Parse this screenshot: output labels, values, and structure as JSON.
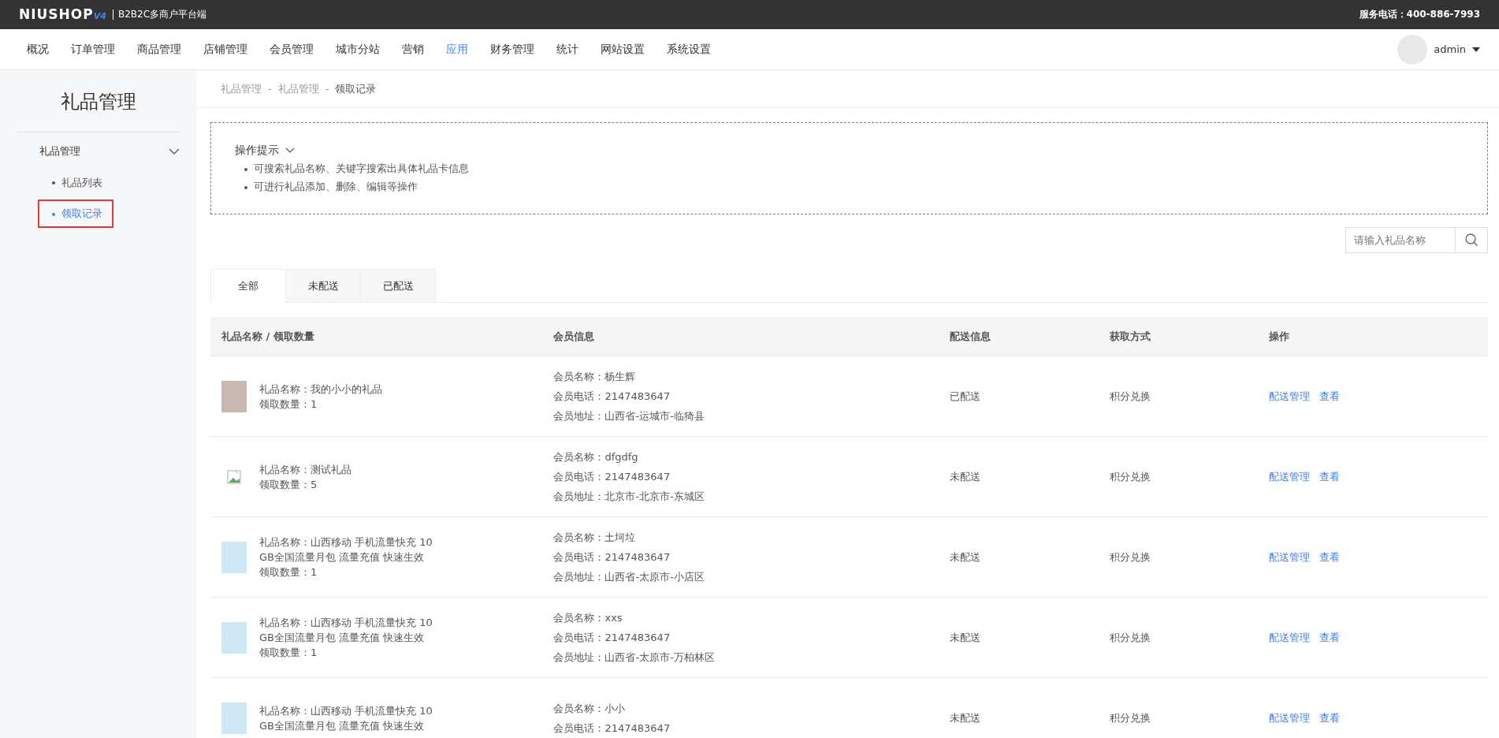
{
  "top_bar": {
    "logo": "NIUSHOP",
    "logo_version": "V4",
    "subtitle": "B2B2C多商户平台端",
    "service_phone": "服务电话：400-886-7993"
  },
  "nav": {
    "items": [
      {
        "label": "概况",
        "selected": false
      },
      {
        "label": "订单管理",
        "selected": false
      },
      {
        "label": "商品管理",
        "selected": false
      },
      {
        "label": "店铺管理",
        "selected": false
      },
      {
        "label": "会员管理",
        "selected": false
      },
      {
        "label": "城市分站",
        "selected": false
      },
      {
        "label": "营销",
        "selected": false
      },
      {
        "label": "应用",
        "selected": true
      },
      {
        "label": "财务管理",
        "selected": false
      },
      {
        "label": "统计",
        "selected": false
      },
      {
        "label": "网站设置",
        "selected": false
      },
      {
        "label": "系统设置",
        "selected": false
      }
    ],
    "user": {
      "name": "admin"
    }
  },
  "sidebar": {
    "title": "礼品管理",
    "groups": [
      {
        "label": "礼品管理",
        "expanded": true,
        "children": [
          {
            "label": "礼品列表",
            "selected": false,
            "highlighted": false
          },
          {
            "label": "领取记录",
            "selected": true,
            "highlighted": true
          }
        ]
      }
    ]
  },
  "breadcrumb": {
    "separator": "-",
    "items": [
      "礼品管理",
      "礼品管理",
      "领取记录"
    ]
  },
  "tips": {
    "title": "操作提示",
    "expanded": true,
    "items": [
      "可搜索礼品名称、关键字搜索出具体礼品卡信息",
      "可进行礼品添加、删除、编辑等操作"
    ]
  },
  "search": {
    "placeholder": "请输入礼品名称"
  },
  "tabs": [
    {
      "label": "全部",
      "selected": true
    },
    {
      "label": "未配送",
      "selected": false
    },
    {
      "label": "已配送",
      "selected": false
    }
  ],
  "table": {
    "columns": [
      "礼品名称 / 领取数量",
      "会员信息",
      "配送信息",
      "获取方式",
      "操作"
    ],
    "rows": [
      {
        "kind": "photo",
        "gift_name": "礼品名称：我的小小的礼品",
        "quantity": "领取数量：1",
        "member_name": "会员名称：杨生辉",
        "member_phone": "会员电话：2147483647",
        "member_address": "会员地址：山西省-运城市-临猗县",
        "delivery": "已配送",
        "method": "积分兑换",
        "actions": [
          "配送管理",
          "查看"
        ]
      },
      {
        "kind": "broken",
        "gift_name": "礼品名称：测试礼品",
        "quantity": "领取数量：5",
        "member_name": "会员名称：dfgdfg",
        "member_phone": "会员电话：2147483647",
        "member_address": "会员地址：北京市-北京市-东城区",
        "delivery": "未配送",
        "method": "积分兑换",
        "actions": [
          "配送管理",
          "查看"
        ]
      },
      {
        "kind": "photo",
        "gift_name": "礼品名称：山西移动 手机流量快充 10 GB全国流量月包 流量充值 快速生效",
        "quantity": "领取数量：1",
        "member_name": "会员名称：土坷垃",
        "member_phone": "会员电话：2147483647",
        "member_address": "会员地址：山西省-太原市-小店区",
        "delivery": "未配送",
        "method": "积分兑换",
        "actions": [
          "配送管理",
          "查看"
        ]
      },
      {
        "kind": "photo",
        "gift_name": "礼品名称：山西移动 手机流量快充 10 GB全国流量月包 流量充值 快速生效",
        "quantity": "领取数量：1",
        "member_name": "会员名称：xxs",
        "member_phone": "会员电话：2147483647",
        "member_address": "会员地址：山西省-太原市-万柏林区",
        "delivery": "未配送",
        "method": "积分兑换",
        "actions": [
          "配送管理",
          "查看"
        ]
      },
      {
        "kind": "photo",
        "gift_name": "礼品名称：山西移动 手机流量快充 10 GB全国流量月包 流量充值 快速生效",
        "member_name": "会员名称：小小",
        "member_phone": "会员电话：2147483647",
        "delivery": "未配送",
        "method": "积分兑换",
        "actions": [
          "配送管理",
          "查看"
        ]
      }
    ]
  }
}
